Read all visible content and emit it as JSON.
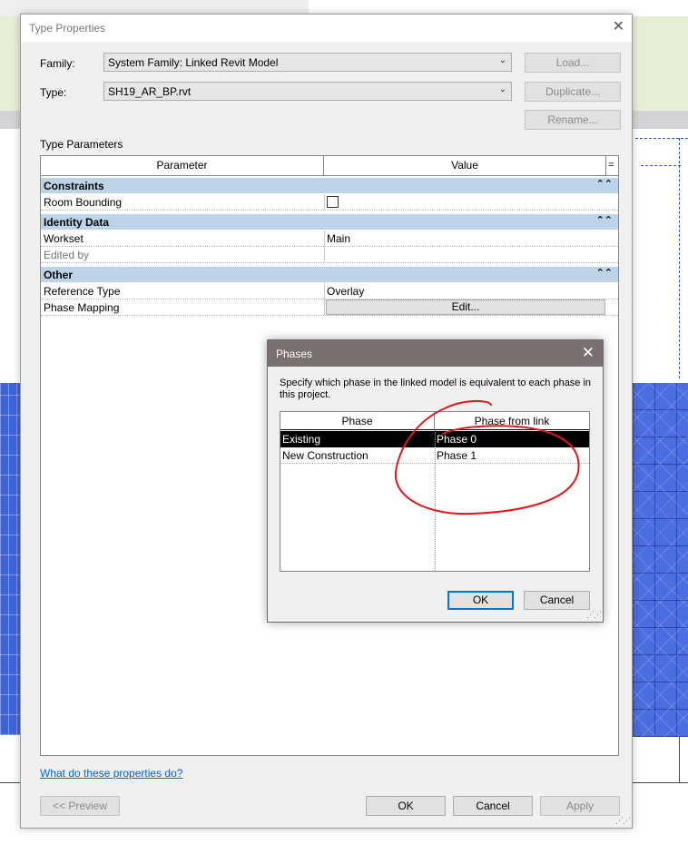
{
  "type_properties": {
    "title": "Type Properties",
    "family_label": "Family:",
    "family_value": "System Family: Linked Revit Model",
    "type_label": "Type:",
    "type_value": "SH19_AR_BP.rvt",
    "load_button": "Load...",
    "duplicate_button": "Duplicate...",
    "rename_button": "Rename...",
    "section_label": "Type Parameters",
    "grid_header": {
      "parameter": "Parameter",
      "value": "Value",
      "sort": "="
    },
    "groups": {
      "constraints": "Constraints",
      "identity": "Identity Data",
      "other": "Other"
    },
    "rows": {
      "room_bounding": "Room Bounding",
      "workset_label": "Workset",
      "workset_value": "Main",
      "edited_by_label": "Edited by",
      "edited_by_value": "",
      "reference_type_label": "Reference Type",
      "reference_type_value": "Overlay",
      "phase_mapping_label": "Phase Mapping",
      "phase_mapping_button": "Edit..."
    },
    "room_bounding_checked": false,
    "help_link": "What do these properties do?",
    "preview_button": "<< Preview",
    "ok_button": "OK",
    "cancel_button": "Cancel",
    "apply_button": "Apply"
  },
  "phases_dialog": {
    "title": "Phases",
    "description": "Specify which phase in the linked model is equivalent to each phase in this project.",
    "columns": [
      "Phase",
      "Phase from link"
    ],
    "rows": [
      {
        "phase": "Existing",
        "from_link": "Phase 0",
        "selected": true
      },
      {
        "phase": "New Construction",
        "from_link": "Phase 1",
        "selected": false
      }
    ],
    "ok_button": "OK",
    "cancel_button": "Cancel"
  },
  "colors": {
    "group_header": "#bdd3e7",
    "phases_titlebar": "#797070",
    "annotation": "#e01818",
    "link": "#0066cc",
    "canvas_blue": "#4a6de0"
  }
}
